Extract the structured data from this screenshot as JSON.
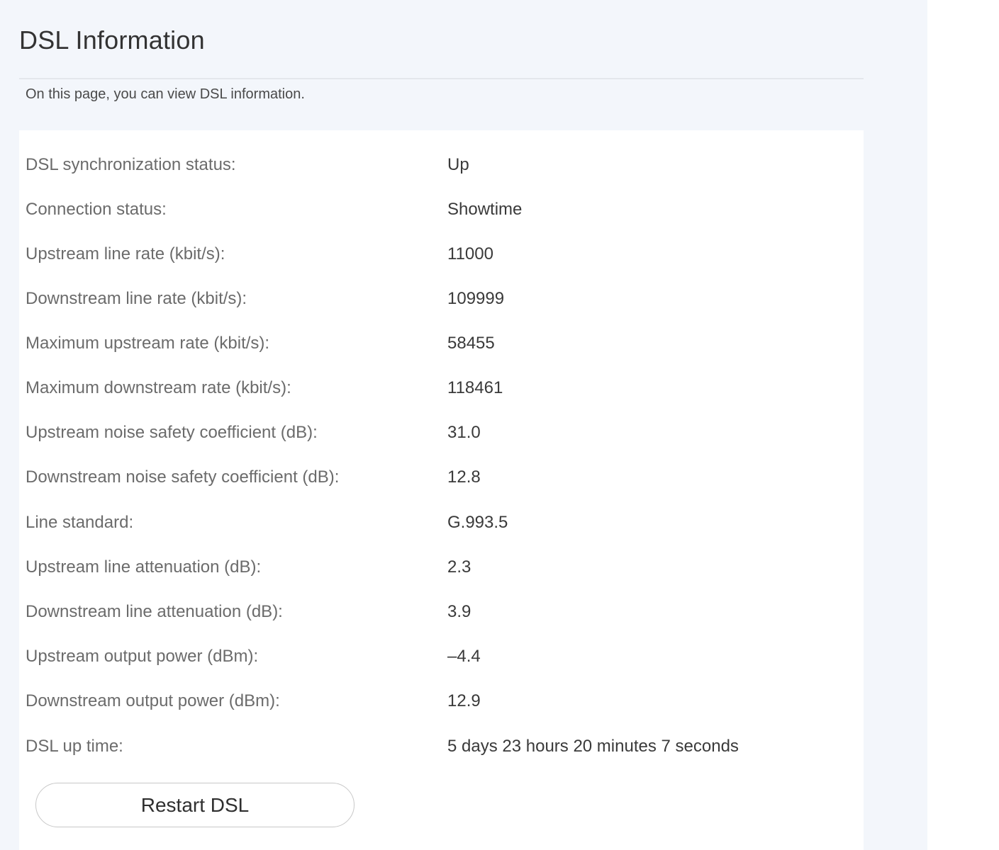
{
  "page": {
    "title": "DSL Information",
    "description": "On this page, you can view DSL information."
  },
  "info": {
    "rows": [
      {
        "label": "DSL synchronization status:",
        "value": "Up"
      },
      {
        "label": "Connection status:",
        "value": "Showtime"
      },
      {
        "label": "Upstream line rate (kbit/s):",
        "value": "11000"
      },
      {
        "label": "Downstream line rate (kbit/s):",
        "value": "109999"
      },
      {
        "label": "Maximum upstream rate (kbit/s):",
        "value": "58455"
      },
      {
        "label": "Maximum downstream rate (kbit/s):",
        "value": "118461"
      },
      {
        "label": "Upstream noise safety coefficient (dB):",
        "value": "31.0"
      },
      {
        "label": "Downstream noise safety coefficient (dB):",
        "value": "12.8"
      },
      {
        "label": "Line standard:",
        "value": "G.993.5"
      },
      {
        "label": "Upstream line attenuation (dB):",
        "value": "2.3"
      },
      {
        "label": "Downstream line attenuation (dB):",
        "value": "3.9"
      },
      {
        "label": "Upstream output power (dBm):",
        "value": "–4.4"
      },
      {
        "label": "Downstream output power (dBm):",
        "value": "12.9"
      },
      {
        "label": "DSL up time:",
        "value": "5 days 23 hours 20 minutes 7 seconds"
      }
    ]
  },
  "actions": {
    "restart_label": "Restart DSL"
  },
  "colors": {
    "page_background": "#f3f6fb",
    "panel_background": "#ffffff",
    "label_text": "#6b6b6b",
    "value_text": "#3a3a3a"
  }
}
